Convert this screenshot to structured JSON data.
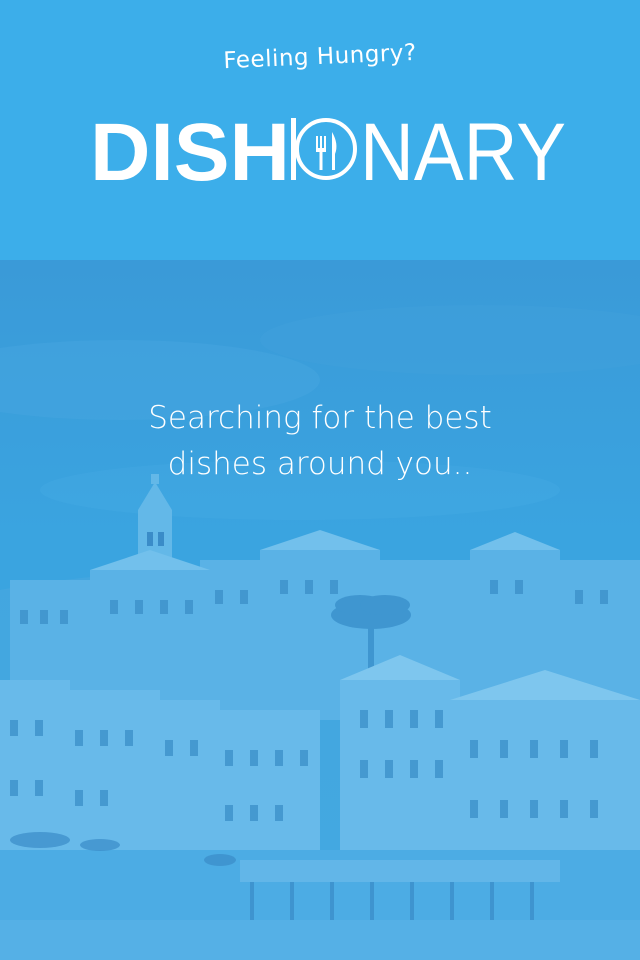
{
  "header": {
    "tagline": "Feeling Hungry?",
    "logo_bold": "DISH",
    "logo_light": "NARY",
    "logo_icon": "fork-knife-plate-icon",
    "background_color": "#3caeea"
  },
  "loading": {
    "line1": "Searching for the best",
    "line2": "dishes around you.."
  },
  "colors": {
    "accent": "#3caeea",
    "overlay": "#3aa6e0",
    "text": "#ffffff"
  }
}
